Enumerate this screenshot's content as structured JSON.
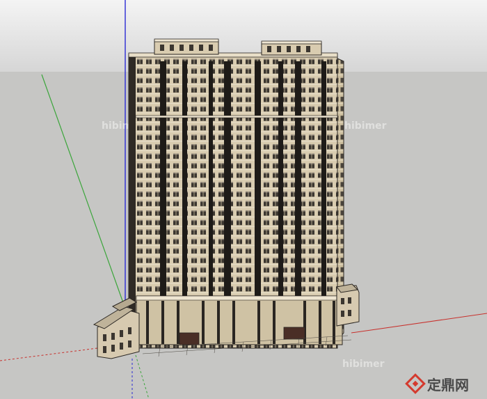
{
  "scene": {
    "sky_color": "#dcdcdc",
    "ground_color": "#c6c6c4",
    "facade_color": "#d9ccb0",
    "facade_shadow_color": "#2a2622",
    "axis_colors": {
      "x": "#c8302c",
      "y": "#3aa53a",
      "z": "#2a2ad4"
    }
  },
  "watermarks": [
    "hibimer",
    "hibimer",
    "hibimer"
  ],
  "logo": {
    "text": "定鼎网",
    "mark_color": "#d43a2e",
    "icon": "diamond-logo-icon"
  }
}
